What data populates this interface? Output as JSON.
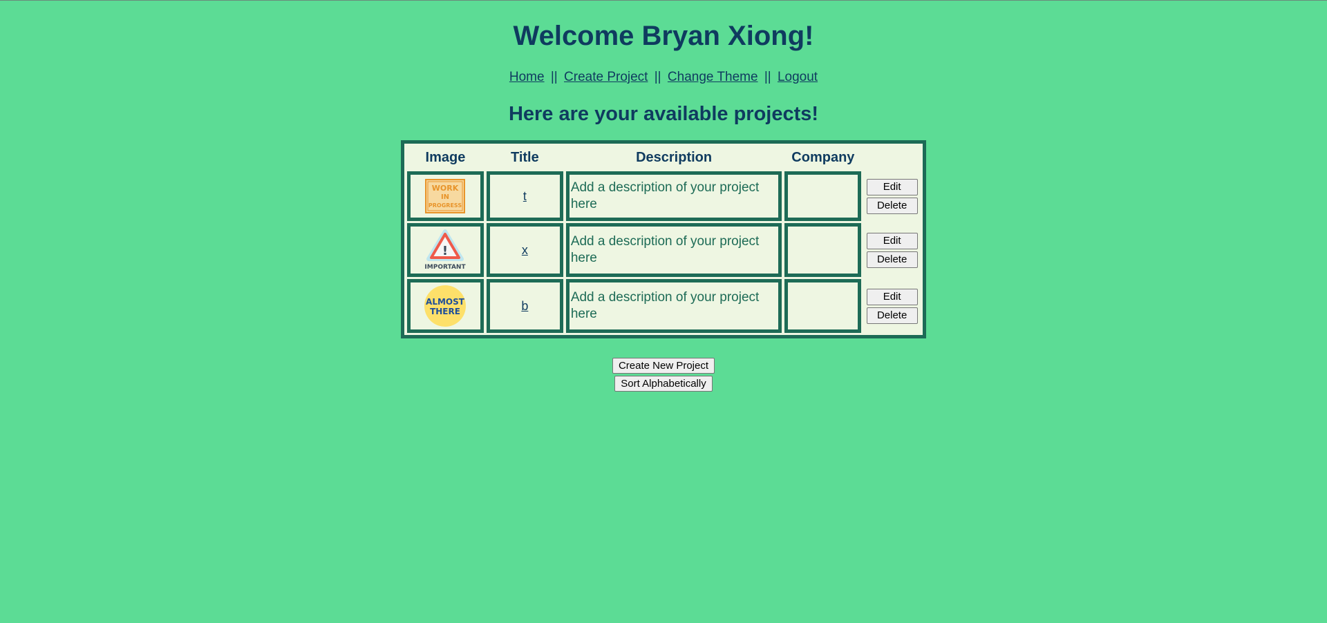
{
  "header": {
    "welcome": "Welcome Bryan Xiong!",
    "subtitle": "Here are your available projects!"
  },
  "nav": {
    "home": "Home",
    "create_project": "Create Project",
    "change_theme": "Change Theme",
    "logout": "Logout",
    "separator": "||"
  },
  "table": {
    "headers": [
      "Image",
      "Title",
      "Description",
      "Company",
      ""
    ],
    "rows": [
      {
        "image_icon": "work-in-progress-badge",
        "image_text": [
          "WORK",
          "IN",
          "PROGRESS"
        ],
        "title": "t",
        "description": "Add a description of your project here",
        "company": "",
        "edit_label": "Edit",
        "delete_label": "Delete"
      },
      {
        "image_icon": "important-warning-badge",
        "image_text": [
          "!",
          "IMPORTANT"
        ],
        "title": "x",
        "description": "Add a description of your project here",
        "company": "",
        "edit_label": "Edit",
        "delete_label": "Delete"
      },
      {
        "image_icon": "almost-there-badge",
        "image_text": [
          "ALMOST",
          "THERE"
        ],
        "title": "b",
        "description": "Add a description of your project here",
        "company": "",
        "edit_label": "Edit",
        "delete_label": "Delete"
      }
    ]
  },
  "actions": {
    "create_new_project": "Create New Project",
    "sort_alphabetically": "Sort Alphabetically"
  },
  "colors": {
    "background": "#5cdc95",
    "heading": "#0f3b5f",
    "table_border": "#1d6b56",
    "cell_background": "#eef6e2"
  }
}
